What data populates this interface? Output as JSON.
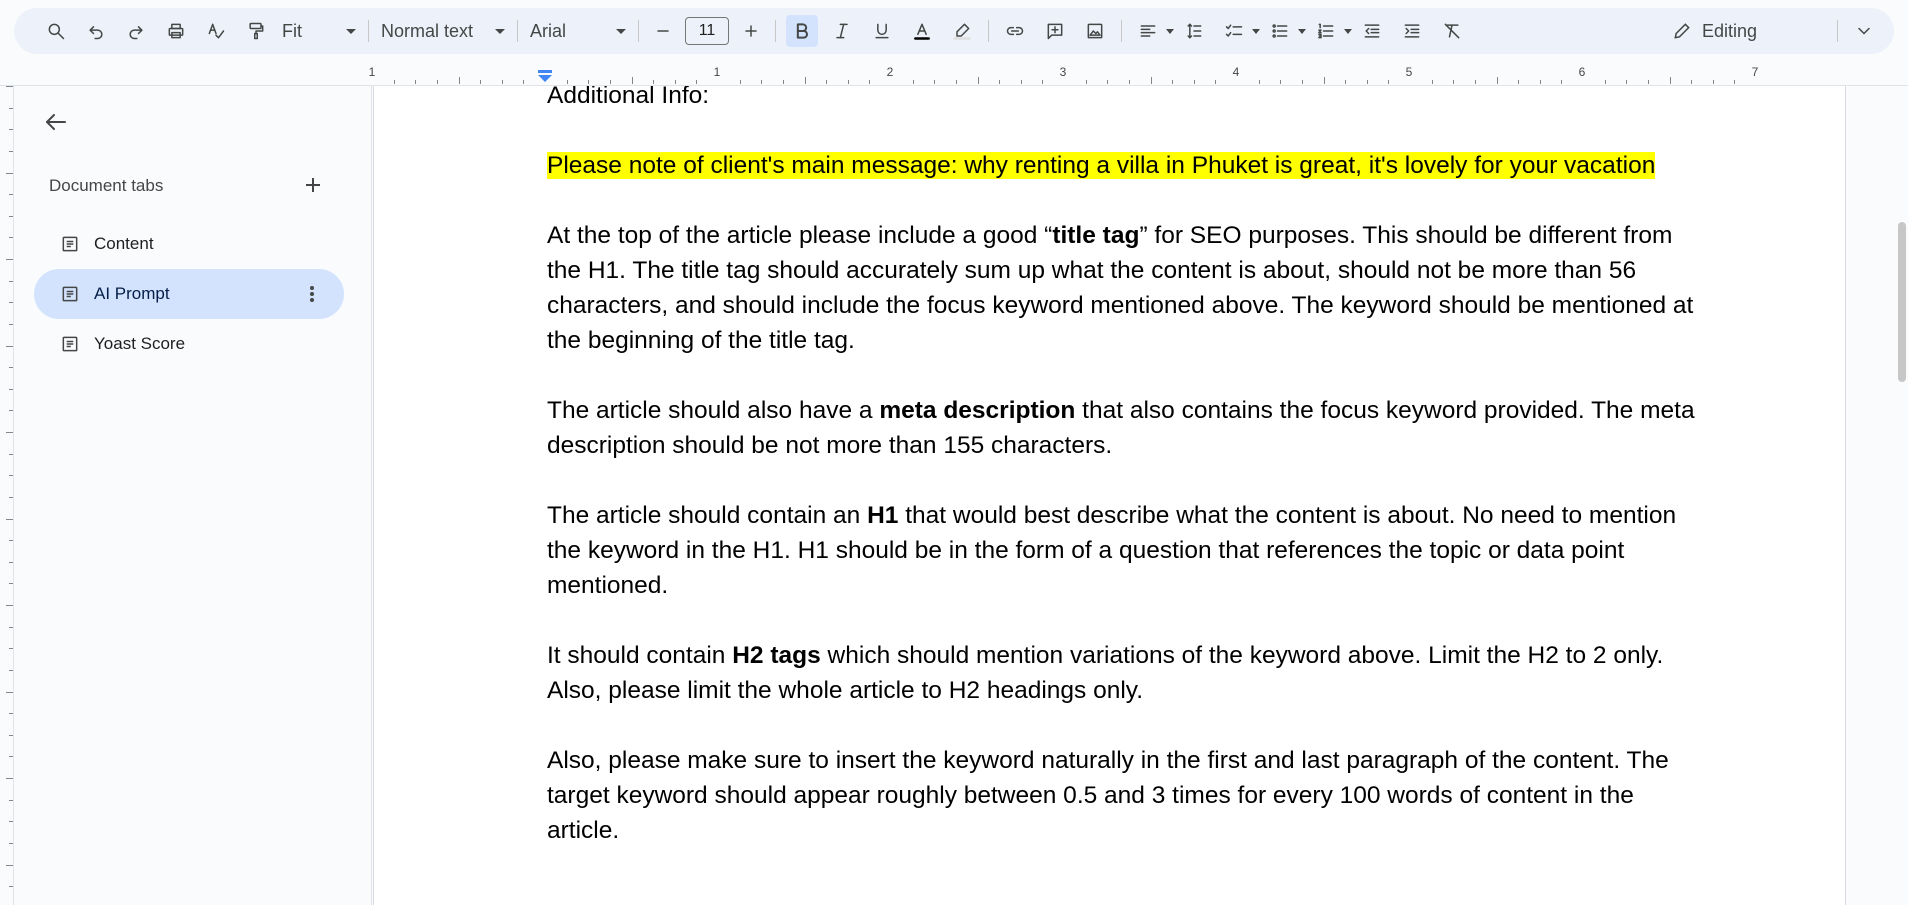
{
  "toolbar": {
    "zoom": "Fit",
    "style": "Normal text",
    "font": "Arial",
    "font_size": "11",
    "mode": "Editing"
  },
  "ruler": {
    "numbers": [
      "1",
      "1",
      "2",
      "3",
      "4",
      "5",
      "6",
      "7"
    ]
  },
  "sidebar": {
    "title": "Document tabs",
    "tabs": [
      {
        "label": "Content"
      },
      {
        "label": "AI Prompt"
      },
      {
        "label": "Yoast Score"
      }
    ]
  },
  "document": {
    "heading_partial": "Additional Info:",
    "highlight_para": "Please note of client's main message: why renting a villa in Phuket is great, it's lovely for your vacation",
    "p1": {
      "a": "At the top of the article please include a good “",
      "b": "title tag",
      "c": "” for SEO purposes. This should be different from the H1. The title tag should accurately sum up what the content is about, should not be more than 56 characters, and should include the focus keyword mentioned above. The keyword should be mentioned at the beginning of the title tag."
    },
    "p2": {
      "a": "The article should also have a ",
      "b": "meta description",
      "c": " that also contains the focus keyword provided. The meta description should be not more than 155 characters."
    },
    "p3": {
      "a": "The article should contain an ",
      "b": "H1",
      "c": " that would best describe what the content is about. No need to mention the keyword in the H1. H1 should be in the form of a question that references the topic or data point mentioned."
    },
    "p4": {
      "a": "It should contain ",
      "b": "H2 tags",
      "c": " which should mention variations of the keyword above. Limit the H2 to 2 only. Also, please limit the whole article to H2 headings only."
    },
    "p5": "Also, please make sure to insert the keyword naturally in the first and last paragraph of the content. The target keyword should appear roughly between 0.5 and 3 times for every 100 words of content in the article."
  },
  "colors": {
    "toolbar_bg": "#edf2fa",
    "selected_tab": "#d3e3fd",
    "highlight": "#ffff00"
  }
}
